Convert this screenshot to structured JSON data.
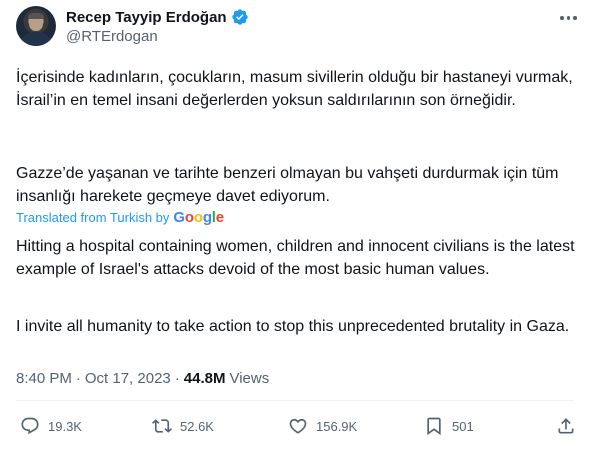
{
  "author": {
    "display_name": "Recep Tayyip Erdoğan",
    "handle": "@RTErdogan",
    "verified": true
  },
  "tweet": {
    "original_paragraphs": [
      "İçerisinde kadınların, çocukların, masum sivillerin olduğu bir hastaneyi vurmak, İsrail’in en temel insani değerlerden yoksun saldırılarının son örneğidir.",
      "Gazze’de yaşanan ve tarihte benzeri olmayan bu vahşeti durdurmak için tüm insanlığı harekete geçmeye davet ediyorum."
    ],
    "translated_label": "Translated from Turkish by",
    "translator_brand": "Google",
    "translated_paragraphs": [
      "Hitting a hospital containing women, children and innocent civilians is the latest example of Israel's attacks devoid of the most basic human values.",
      "I invite all humanity to take action to stop this unprecedented brutality in Gaza."
    ],
    "time": "8:40 PM",
    "date": "Oct 17, 2023",
    "separator": "·",
    "views_count": "44.8M",
    "views_label": "Views"
  },
  "actions": {
    "reply_count": "19.3K",
    "retweet_count": "52.6K",
    "like_count": "156.9K",
    "bookmark_count": "501"
  },
  "colors": {
    "link": "#1d9bf0",
    "secondary_text": "#536471",
    "primary_text": "#0f1419",
    "verified_badge": "#1d9bf0"
  },
  "icons": [
    "more-icon",
    "verified-badge-icon",
    "reply-icon",
    "retweet-icon",
    "like-icon",
    "bookmark-icon",
    "share-icon"
  ]
}
